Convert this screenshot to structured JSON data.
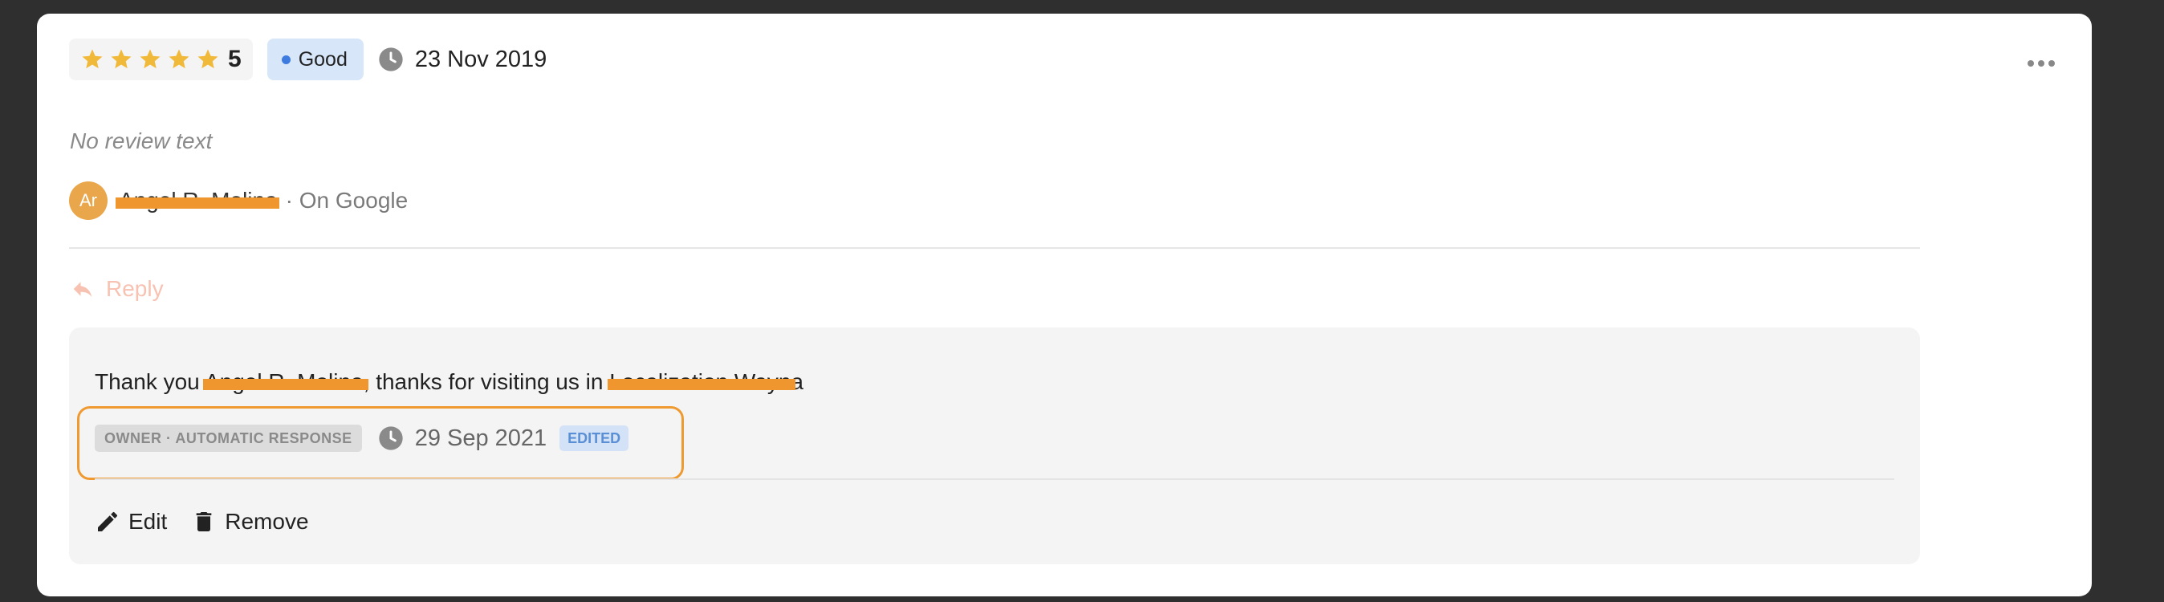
{
  "review": {
    "rating_value": "5",
    "stars_filled": 5,
    "stars_total": 5,
    "sentiment_label": "Good",
    "date": "23 Nov 2019",
    "no_review_text": "No review text",
    "author_initials": "Ar",
    "author_name": "Angel R. Molina",
    "source": "· On Google",
    "reply_label": "Reply"
  },
  "response": {
    "text_prefix": "Thank you ",
    "redacted_name": "Angel R. Molina",
    "text_middle": ", thanks for visiting us in ",
    "redacted_location": "Localization Wayn",
    "text_suffix": "a",
    "owner_label": "OWNER · AUTOMATIC RESPONSE",
    "date": "29 Sep 2021",
    "edited_label": "EDITED",
    "edit_label": "Edit",
    "remove_label": "Remove"
  },
  "colors": {
    "star": "#f1b93a",
    "avatar": "#e9a64a",
    "reply": "#f7c2b1",
    "highlight": "#ef9a30",
    "redaction": "#f0962e",
    "good_badge": "#d7e6f8"
  },
  "icons": [
    "star-icon",
    "clock-icon",
    "more-icon",
    "reply-icon",
    "edit-icon",
    "trash-icon"
  ]
}
